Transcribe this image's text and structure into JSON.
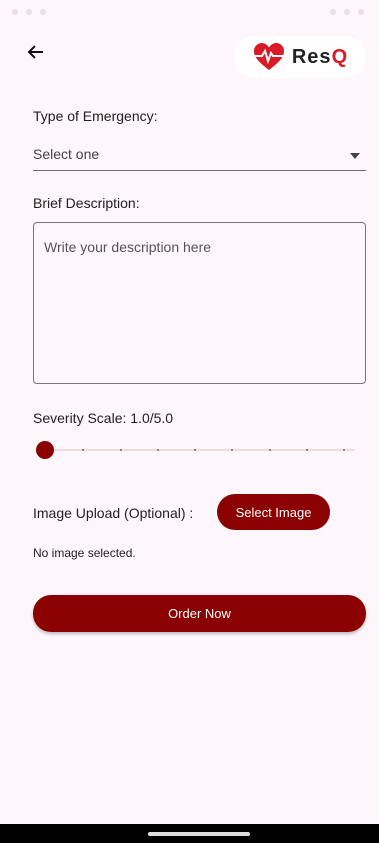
{
  "app": {
    "brand_prefix": "Res",
    "brand_suffix": "Q"
  },
  "form": {
    "type_label": "Type of Emergency:",
    "type_value": "Select one",
    "description_label": "Brief Description:",
    "description_placeholder": "Write your description here",
    "severity_label": "Severity Scale: 1.0/5.0",
    "severity": {
      "value": 1.0,
      "min": 1.0,
      "max": 5.0,
      "divisions": 8
    },
    "image_label": "Image Upload (Optional) :",
    "select_image_label": "Select Image",
    "no_image_text": "No image selected.",
    "order_label": "Order Now"
  },
  "colors": {
    "accent": "#8b0000",
    "logo_red": "#d81b27",
    "background": "#fdf6fb"
  },
  "icons": {
    "back": "arrow-left-icon",
    "logo": "heart-pulse-icon",
    "dropdown": "triangle-down-icon"
  }
}
